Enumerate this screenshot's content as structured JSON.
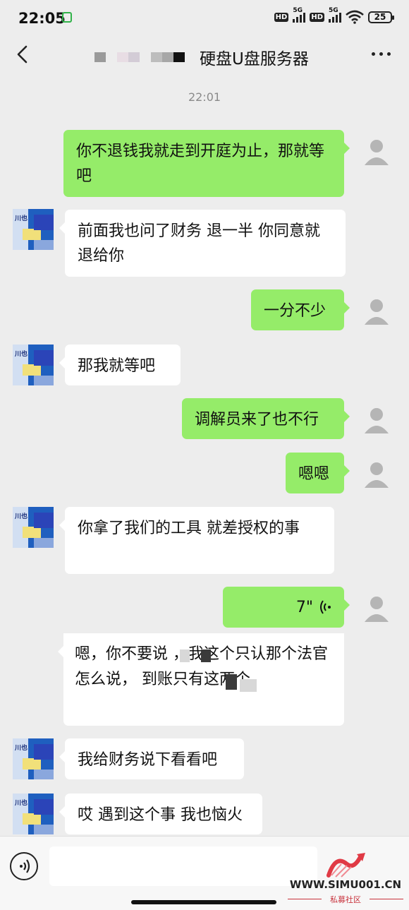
{
  "status_bar": {
    "time": "22:05",
    "hd1": "HD",
    "net1": "5G",
    "hd2": "HD",
    "net2": "5G",
    "battery": "25"
  },
  "header": {
    "title": "硬盘U盘服务器",
    "back_icon": "chevron-left-icon",
    "more_icon": "ellipsis-icon"
  },
  "timestamp": "22:01",
  "messages": [
    {
      "side": "out",
      "text": "你不退钱我就走到开庭为止，那就等吧"
    },
    {
      "side": "in",
      "text": "前面我也问了财务  退一半  你同意就退给你"
    },
    {
      "side": "out",
      "text": "一分不少"
    },
    {
      "side": "in",
      "text": "那我就等吧"
    },
    {
      "side": "out",
      "text": "调解员来了也不行"
    },
    {
      "side": "out",
      "text": "嗯嗯"
    },
    {
      "side": "in",
      "text": "你拿了我们的工具     就差授权的事"
    },
    {
      "side": "out",
      "type": "voice",
      "duration": "7\""
    },
    {
      "side": "in",
      "text": "嗯，你不要说      ，我这个只认那个法官怎么说，        到账只有这两个。"
    },
    {
      "side": "in",
      "text": "我给财务说下看看吧"
    },
    {
      "side": "in",
      "text": "哎 遇到这个事  我也恼火"
    }
  ],
  "avatar_text": "川也",
  "watermark": {
    "url": "WWW.SIMU001.CN",
    "sub": "私募社区"
  },
  "colors": {
    "background": "#ededed",
    "bubble_out": "#95ec69",
    "bubble_in": "#ffffff"
  }
}
